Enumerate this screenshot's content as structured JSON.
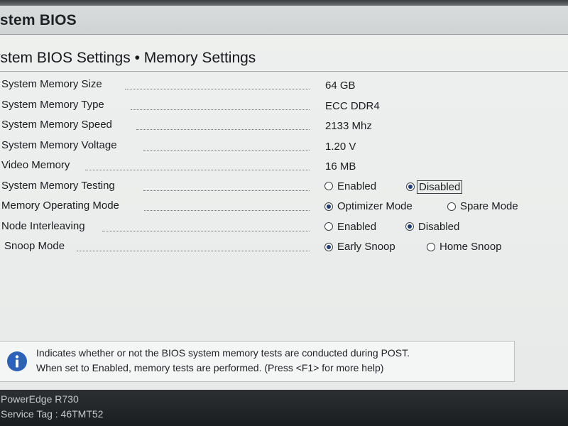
{
  "app": {
    "title": "ystem BIOS"
  },
  "page": {
    "title": "ystem BIOS Settings • Memory Settings"
  },
  "settings": [
    {
      "label": "System Memory Size",
      "value": "64 GB"
    },
    {
      "label": "System Memory Type",
      "value": "ECC DDR4"
    },
    {
      "label": "System Memory Speed",
      "value": "2133 Mhz"
    },
    {
      "label": "System Memory Voltage",
      "value": "1.20 V"
    },
    {
      "label": "Video Memory",
      "value": "16 MB"
    },
    {
      "label": "System Memory Testing",
      "options": [
        "Enabled",
        "Disabled"
      ],
      "selected": "Disabled"
    },
    {
      "label": "Memory Operating Mode",
      "options": [
        "Optimizer Mode",
        "Spare Mode"
      ],
      "selected": "Optimizer Mode"
    },
    {
      "label": "Node Interleaving",
      "options": [
        "Enabled",
        "Disabled"
      ],
      "selected": "Disabled"
    },
    {
      "label": "Snoop Mode",
      "options": [
        "Early Snoop",
        "Home Snoop"
      ],
      "selected": "Early Snoop"
    }
  ],
  "help": {
    "icon": "info-icon",
    "line1": "Indicates whether or not the BIOS system memory tests are conducted during POST.",
    "line2": "When set to Enabled, memory tests are performed. (Press <F1> for more help)"
  },
  "footer": {
    "model": "PowerEdge R730",
    "service_tag": "Service Tag : 46TMT52"
  },
  "colors": {
    "background": "#eceeed",
    "header": "#d3d7d8",
    "footer": "#1f2225",
    "radio_dot": "#1f3b78",
    "info_icon": "#2b62b8"
  }
}
